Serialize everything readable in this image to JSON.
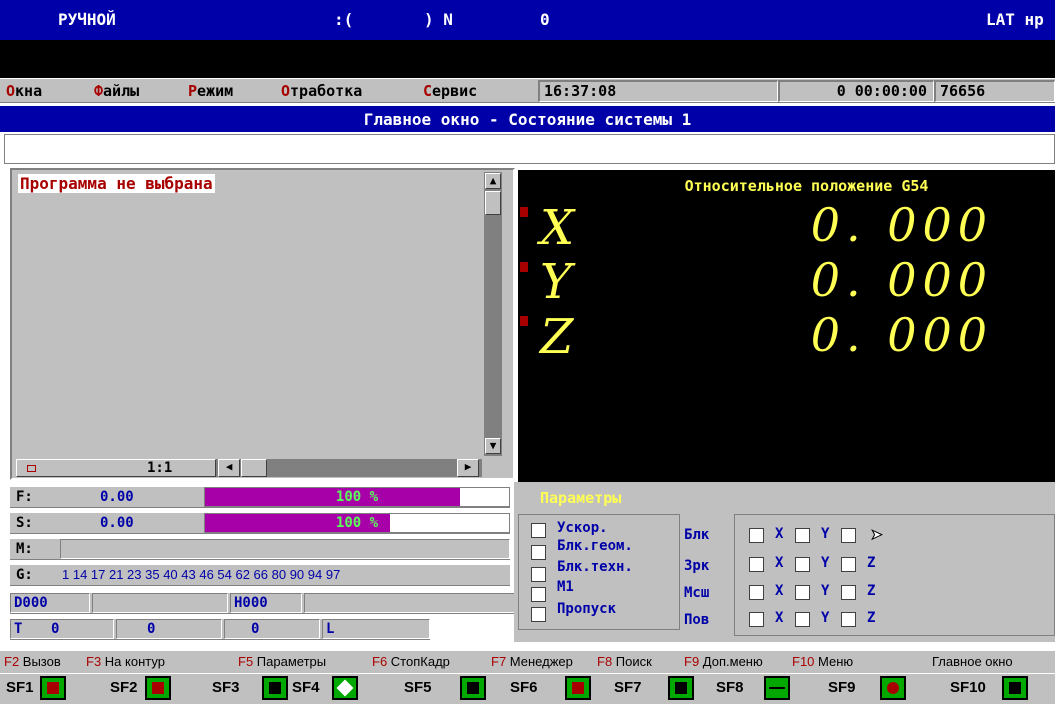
{
  "status": {
    "mode": "РУЧНОЙ",
    "indicator": ":(",
    "n_label": ") N",
    "n_value": "0",
    "keyboard": "LAT нр"
  },
  "menu": {
    "items": [
      {
        "hot": "О",
        "rest": "кна"
      },
      {
        "hot": "Ф",
        "rest": "айлы"
      },
      {
        "hot": "Р",
        "rest": "ежим"
      },
      {
        "hot": "О",
        "rest": "тработка"
      },
      {
        "hot": "С",
        "rest": "ервис"
      }
    ],
    "clock": "16:37:08",
    "elapsed": "0 00:00:00",
    "counter": "76656"
  },
  "window_title": "Главное окно - Состояние системы 1",
  "program": {
    "title": "Программа не выбрана",
    "scale": "1:1"
  },
  "coords": {
    "title": "Относительное положение G54",
    "axes": [
      {
        "name": "X",
        "value": "0.000"
      },
      {
        "name": "Y",
        "value": "0.000"
      },
      {
        "name": "Z",
        "value": "0.000"
      }
    ]
  },
  "feed": {
    "label": "F:",
    "value": "0.00",
    "override": "100 %",
    "override_fraction": 0.84
  },
  "spindle": {
    "label": "S:",
    "value": "0.00",
    "override": "100 %",
    "override_fraction": 0.61
  },
  "mcodes": {
    "label": "M:"
  },
  "gcodes": {
    "label": "G:",
    "value": "1 14 17 21 23 35 40 43 46 54 62 66 80 90 94 97"
  },
  "dh": {
    "d": "D000",
    "h": "H000"
  },
  "tool": {
    "t_label": "T",
    "t_value": "0",
    "v2": "0",
    "v3": "0",
    "l_label": "L"
  },
  "params": {
    "title": "Параметры",
    "options": [
      "Ускор.",
      "Блк.геом.",
      "Блк.техн.",
      "M1",
      "Пропуск"
    ],
    "groups": [
      "Блк",
      "Зрк",
      "Мсш",
      "Пов"
    ],
    "axes": [
      "X",
      "Y",
      "Z"
    ]
  },
  "fkeys": [
    {
      "key": "F2",
      "label": "Вызов"
    },
    {
      "key": "F3",
      "label": "На контур"
    },
    {
      "key": "F5",
      "label": "Параметры"
    },
    {
      "key": "F6",
      "label": "СтопКадр"
    },
    {
      "key": "F7",
      "label": "Менеджер"
    },
    {
      "key": "F8",
      "label": "Поиск"
    },
    {
      "key": "F9",
      "label": "Доп.меню"
    },
    {
      "key": "F10",
      "label": "Меню"
    }
  ],
  "fkey_right": "Главное окно",
  "sfkeys": [
    "SF1",
    "SF2",
    "SF3",
    "SF4",
    "SF5",
    "SF6",
    "SF7",
    "SF8",
    "SF9",
    "SF10"
  ],
  "colors": {
    "accent_blue": "#0000a8",
    "bar_magenta": "#a800a8",
    "coord_yellow": "#ffff54",
    "icon_green": "#00a800"
  }
}
